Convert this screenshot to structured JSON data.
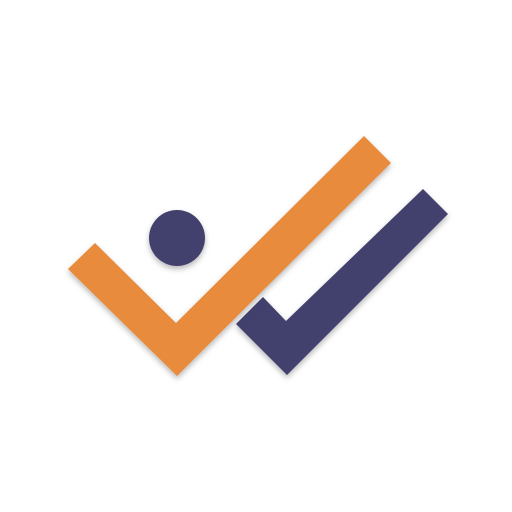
{
  "logo": {
    "name": "double-checkmark-logo",
    "colors": {
      "background": "#ffffff",
      "orange_check": "#e98b3e",
      "purple_check": "#433f6c",
      "purple_dot": "#433f6c"
    },
    "elements": [
      "orange-check-mark",
      "purple-check-mark",
      "purple-dot"
    ]
  }
}
